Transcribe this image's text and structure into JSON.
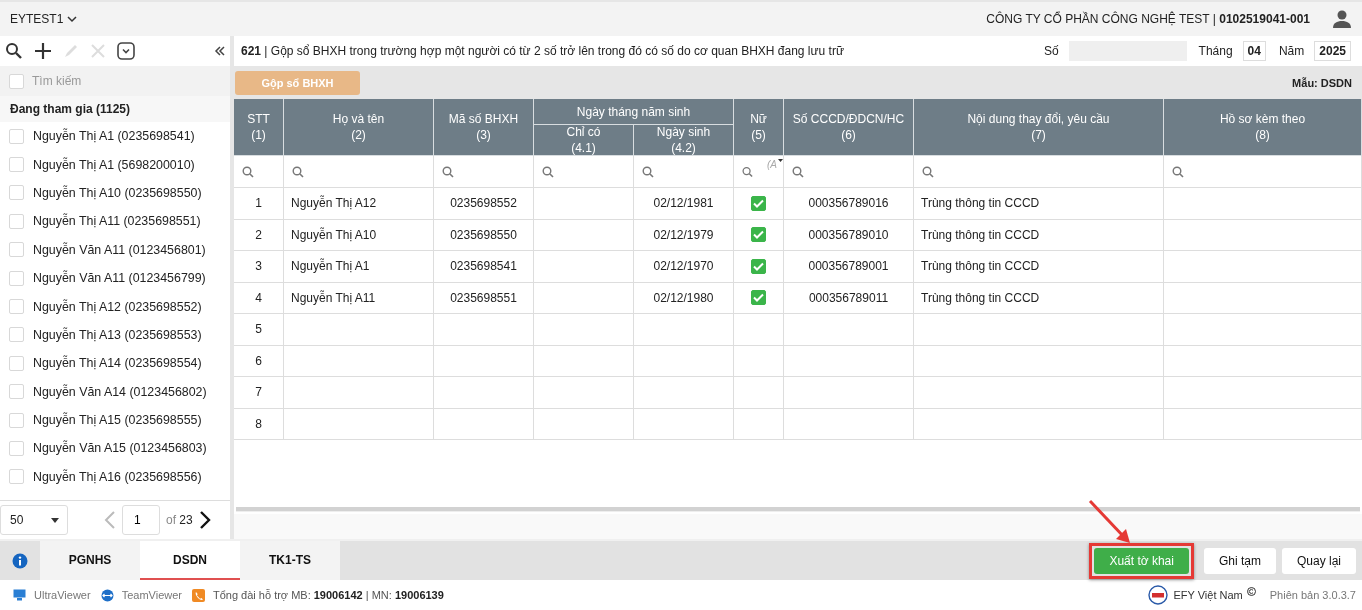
{
  "header": {
    "company_selector": "EYTEST1",
    "company_name": "CÔNG TY CỔ PHẦN CÔNG NGHỆ TEST | **0102519041-001**"
  },
  "sidebar": {
    "search_placeholder": "Tìm kiếm",
    "select_all_checked": false,
    "group_title": "Đang tham gia (1125)",
    "items": [
      {
        "label": "Nguyễn Thị A1 (0235698541)",
        "checked": false
      },
      {
        "label": "Nguyễn Thị A1 (5698200010)",
        "checked": false
      },
      {
        "label": "Nguyễn Thị A10 (0235698550)",
        "checked": false
      },
      {
        "label": "Nguyễn Thị A11 (0235698551)",
        "checked": false
      },
      {
        "label": "Nguyễn Văn A11 (0123456801)",
        "checked": false
      },
      {
        "label": "Nguyễn Văn A11 (0123456799)",
        "checked": false
      },
      {
        "label": "Nguyễn Thị A12 (0235698552)",
        "checked": false
      },
      {
        "label": "Nguyễn Thị A13 (0235698553)",
        "checked": false
      },
      {
        "label": "Nguyễn Thị A14 (0235698554)",
        "checked": false
      },
      {
        "label": "Nguyễn Văn A14 (0123456802)",
        "checked": false
      },
      {
        "label": "Nguyễn Thị A15 (0235698555)",
        "checked": false
      },
      {
        "label": "Nguyễn Văn A15 (0123456803)",
        "checked": false
      },
      {
        "label": "Nguyễn Thị A16 (0235698556)",
        "checked": false
      }
    ],
    "pagination": {
      "page_size": "50",
      "page": "1",
      "of_label": "of",
      "total_pages": "23"
    }
  },
  "form": {
    "title": "**621** | Gộp sổ BHXH trong trường hợp một người có từ 2 số trở lên trong đó có số do cơ quan BHXH đang lưu trữ",
    "number_label": "Số",
    "month_label": "Tháng",
    "month": "04",
    "year_label": "Năm",
    "year": "2025",
    "merge_button": "Gộp sổ BHXH",
    "template_label": "Mẫu: DSDN"
  },
  "table": {
    "columns": [
      {
        "kind": "single",
        "title": "STT",
        "number": "(1)"
      },
      {
        "kind": "single",
        "title": "Họ và tên",
        "number": "(2)"
      },
      {
        "kind": "single",
        "title": "Mã số BHXH",
        "number": "(3)"
      },
      {
        "kind": "group",
        "title": "Ngày tháng năm sinh",
        "children": [
          {
            "title": "Chỉ có",
            "number": "(4.1)"
          },
          {
            "title": "Ngày sinh",
            "number": "(4.2)"
          }
        ]
      },
      {
        "kind": "single",
        "title": "Nữ",
        "number": "(5)"
      },
      {
        "kind": "single",
        "title": "Số CCCD/ĐDCN/HC",
        "number": "(6)"
      },
      {
        "kind": "single",
        "title": "Nội dung thay đổi, yêu cầu",
        "number": "(7)"
      },
      {
        "kind": "single",
        "title": "Hồ sơ kèm theo",
        "number": "(8)"
      }
    ],
    "gender_filter": "(A",
    "rows": [
      {
        "stt": "1",
        "name": "Nguyễn Thị A12",
        "bhxh_no": "0235698552",
        "birth_date": "02/12/1981",
        "female": true,
        "id_no": "000356789016",
        "change": "Trùng thông tin CCCD"
      },
      {
        "stt": "2",
        "name": "Nguyễn Thị A10",
        "bhxh_no": "0235698550",
        "birth_date": "02/12/1979",
        "female": true,
        "id_no": "000356789010",
        "change": "Trùng thông tin CCCD"
      },
      {
        "stt": "3",
        "name": "Nguyễn Thị A1",
        "bhxh_no": "0235698541",
        "birth_date": "02/12/1970",
        "female": true,
        "id_no": "000356789001",
        "change": "Trùng thông tin CCCD"
      },
      {
        "stt": "4",
        "name": "Nguyễn Thị A11",
        "bhxh_no": "0235698551",
        "birth_date": "02/12/1980",
        "female": true,
        "id_no": "000356789011",
        "change": "Trùng thông tin CCCD"
      },
      {
        "stt": "5"
      },
      {
        "stt": "6"
      },
      {
        "stt": "7"
      },
      {
        "stt": "8"
      }
    ]
  },
  "bottom_tabs": [
    {
      "label": "PGNHS",
      "selected": false
    },
    {
      "label": "DSDN",
      "selected": true
    },
    {
      "label": "TK1-TS",
      "selected": false
    }
  ],
  "actions": [
    {
      "label": "Xuất tờ khai",
      "kind": "primary",
      "highlighted": true
    },
    {
      "label": "Ghi tạm",
      "kind": "default",
      "highlighted": false
    },
    {
      "label": "Quay lại",
      "kind": "default",
      "highlighted": false
    }
  ],
  "footer": {
    "links": [
      {
        "kind": "ultraviewer",
        "label": "UltraViewer"
      },
      {
        "kind": "teamviewer",
        "label": "TeamViewer"
      }
    ],
    "support": "Tổng đài hỗ trợ MB: **19006142** | MN: **19006139**",
    "brand": "EFY Việt Nam",
    "version": "Phiên bản 3.0.3.7"
  }
}
